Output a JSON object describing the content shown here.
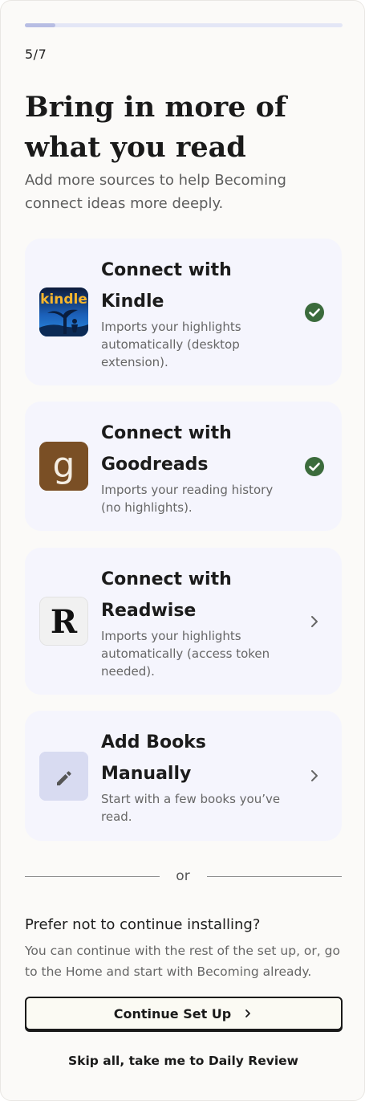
{
  "progress": {
    "step_label": "5/7",
    "fraction": 0.096
  },
  "header": {
    "title": "Bring in more of what you read",
    "subtitle": "Add more sources to help Becoming connect ideas more deeply."
  },
  "sources": [
    {
      "title": "Connect with Kindle",
      "description": "Imports your highlights automatically (desktop extension).",
      "status": "connected",
      "logo_text": "kindle",
      "status_icon": "check-circle-icon"
    },
    {
      "title": "Connect with Goodreads",
      "description": "Imports your reading history (no highlights).",
      "status": "connected",
      "logo_text": "g",
      "status_icon": "check-circle-icon"
    },
    {
      "title": "Connect with Readwise",
      "description": "Imports your highlights automatically (access token needed).",
      "status": "not-connected",
      "logo_text": "R",
      "status_icon": "chevron-right-icon"
    },
    {
      "title": "Add Books Manually",
      "description": "Start with a few books you’ve read.",
      "status": "not-connected",
      "logo_icon": "pencil-icon",
      "status_icon": "chevron-right-icon"
    }
  ],
  "divider_text": "or",
  "footer": {
    "prefer_title": "Prefer not to continue installing?",
    "prefer_description": "You can continue with the rest of the set up, or, go to the Home and start with Becoming already.",
    "continue_label": "Continue Set Up",
    "skip_label": "Skip all, take me to Daily Review"
  },
  "colors": {
    "background": "#fbfaf8",
    "card": "#f5f5fd",
    "check": "#3b6b3c",
    "progress_track": "#e3e6f6",
    "progress_fill": "#b7bde3",
    "goodreads": "#7a4f25",
    "manual_tile": "#d8dbf1"
  }
}
